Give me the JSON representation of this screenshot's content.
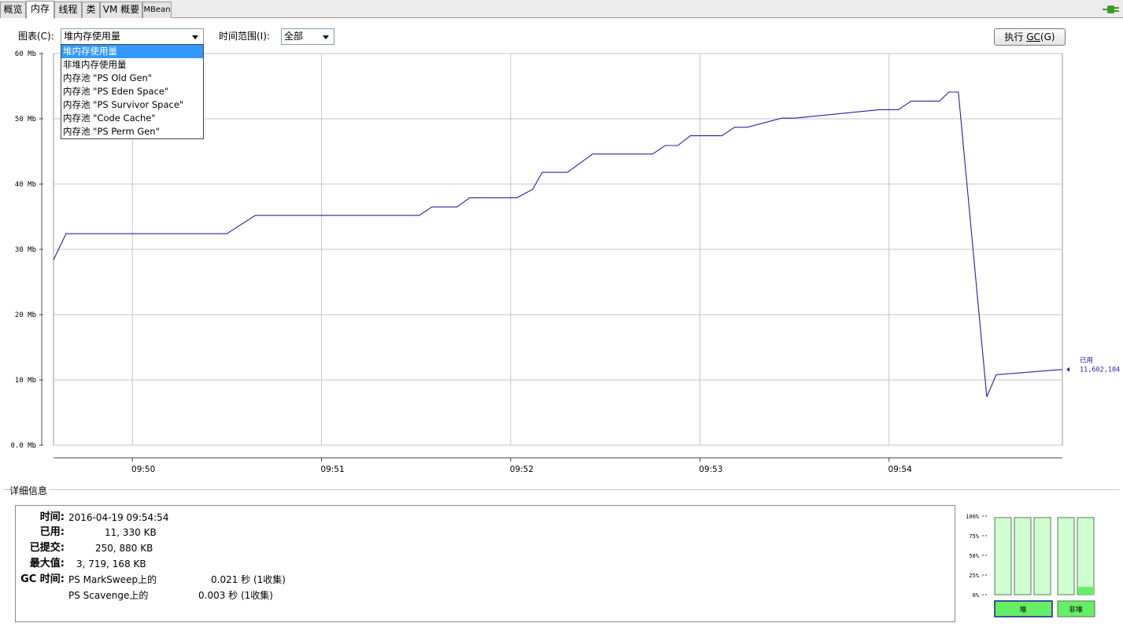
{
  "tabs": [
    {
      "label": "概览",
      "active": false
    },
    {
      "label": "内存",
      "active": true
    },
    {
      "label": "线程",
      "active": false
    },
    {
      "label": "类",
      "active": false
    },
    {
      "label": "VM 概要",
      "active": false
    },
    {
      "label": "MBean",
      "active": false
    }
  ],
  "toolbar": {
    "chart_label": "图表(C):",
    "chart_selected": "堆内存使用量",
    "range_label": "时间范围(I):",
    "range_selected": "全部",
    "gc_button_prefix": "执行 ",
    "gc_button_key": "GC",
    "gc_button_suffix": "(G)"
  },
  "chart_options": [
    "堆内存使用量",
    "非堆内存使用量",
    "内存池 \"PS Old Gen\"",
    "内存池 \"PS Eden Space\"",
    "内存池 \"PS Survivor Space\"",
    "内存池 \"Code Cache\"",
    "内存池 \"PS Perm Gen\""
  ],
  "chart_data": {
    "type": "line",
    "title": "",
    "x_ticks": [
      "09:50",
      "09:51",
      "09:52",
      "09:53",
      "09:54"
    ],
    "y_ticks": [
      "0.0 Mb",
      "10 Mb",
      "20 Mb",
      "30 Mb",
      "40 Mb",
      "50 Mb",
      "60 Mb"
    ],
    "ylim": [
      0,
      60
    ],
    "xlim": [
      "09:49:35",
      "09:54:55"
    ],
    "grid": true,
    "line_color": "#2323a0",
    "series": [
      {
        "name": "已用",
        "x": [
          "09:49:35",
          "09:49:39",
          "09:50:30",
          "09:50:39",
          "09:51:31",
          "09:51:35",
          "09:51:43",
          "09:51:47",
          "09:52:02",
          "09:52:07",
          "09:52:10",
          "09:52:18",
          "09:52:26",
          "09:52:45",
          "09:52:49",
          "09:52:53",
          "09:52:57",
          "09:53:07",
          "09:53:11",
          "09:53:15",
          "09:53:26",
          "09:53:30",
          "09:53:57",
          "09:54:03",
          "09:54:07",
          "09:54:16",
          "09:54:19",
          "09:54:22",
          "09:54:31",
          "09:54:34",
          "09:54:55"
        ],
        "values": [
          28.4,
          32.4,
          32.4,
          35.2,
          35.2,
          36.5,
          36.5,
          37.9,
          37.9,
          39.2,
          41.8,
          41.8,
          44.6,
          44.6,
          45.9,
          45.9,
          47.4,
          47.4,
          48.7,
          48.7,
          50.1,
          50.1,
          51.4,
          51.4,
          52.7,
          52.7,
          54.1,
          54.1,
          7.4,
          10.8,
          11.6
        ]
      }
    ],
    "current_label": "已用",
    "current_value": "11,602,104"
  },
  "details": {
    "section_title": "详细信息",
    "rows": [
      {
        "key": "时间:",
        "value": "2016-04-19 09:54:54"
      },
      {
        "key": "已用:",
        "value": "11, 330 KB"
      },
      {
        "key": "已提交:",
        "value": "250, 880 KB"
      },
      {
        "key": "最大值:",
        "value": "3, 719, 168 KB"
      }
    ],
    "gc_key": "GC 时间:",
    "gc": [
      {
        "name": "PS MarkSweep上的",
        "time": "0.021 秒 (1收集)"
      },
      {
        "name": "PS Scavenge上的",
        "time": "0.003 秒 (1收集)"
      }
    ]
  },
  "usage_bars": {
    "ticks": [
      "100%",
      "75%",
      "50%",
      "25%",
      "0%"
    ],
    "heap_fills": [
      0.0,
      0.0,
      0.0
    ],
    "nonheap_fills": [
      0.0,
      0.1
    ],
    "heap_label": "堆",
    "nonheap_label": "非堆",
    "colors": {
      "bar": "#cfffcf",
      "fill": "#66ee66",
      "border": "#557755"
    }
  }
}
